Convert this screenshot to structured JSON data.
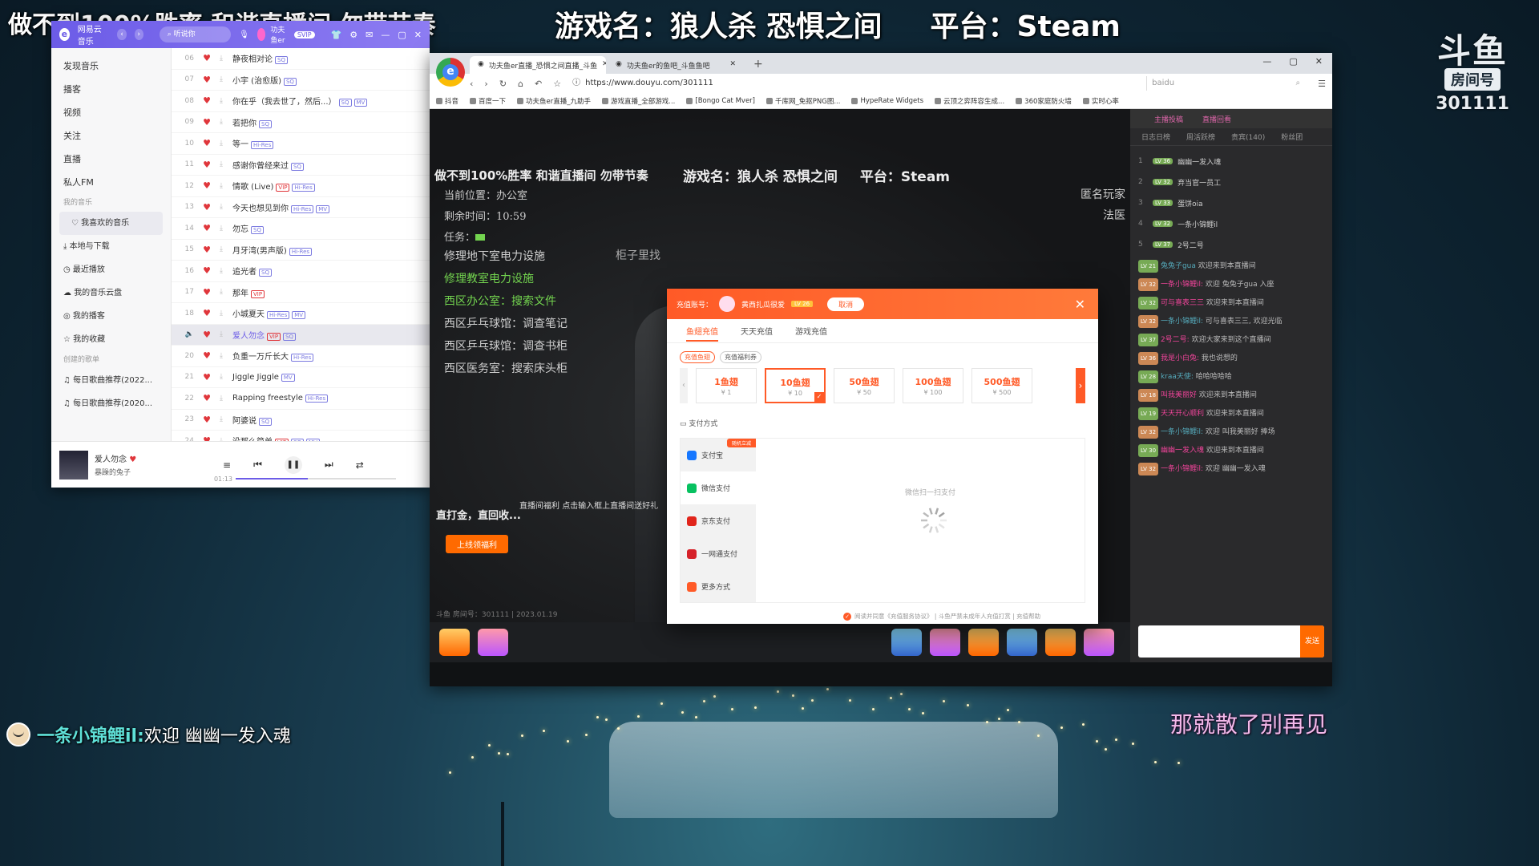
{
  "overlay": {
    "top_left_banner": "做不到100%胜率 和谐直播间 勿带节奏",
    "game_label": "游戏名：狼人杀 恐惧之间",
    "platform_label": "平台：Steam",
    "logo_text": "斗鱼",
    "logo_badge": "房间号",
    "room_number": "301111",
    "chat_user": "一条小锦鲤il:",
    "chat_message": "欢迎 幽幽一发入魂",
    "lyric": "那就散了别再见"
  },
  "music": {
    "app_name": "网易云音乐",
    "search_placeholder": "听说你",
    "user_name": "功夫鱼er",
    "user_vip": "SVIP",
    "nav": [
      {
        "label": "发现音乐"
      },
      {
        "label": "播客"
      },
      {
        "label": "视频"
      },
      {
        "label": "关注"
      },
      {
        "label": "直播"
      },
      {
        "label": "私人FM"
      }
    ],
    "my_music_section": "我的音乐",
    "my_items": [
      {
        "label": "我喜欢的音乐"
      },
      {
        "label": "本地与下载"
      },
      {
        "label": "最近播放"
      },
      {
        "label": "我的音乐云盘"
      },
      {
        "label": "我的播客"
      },
      {
        "label": "我的收藏"
      }
    ],
    "created_section": "创建的歌单",
    "playlists": [
      {
        "label": "每日歌曲推荐(2022..."
      },
      {
        "label": "每日歌曲推荐(2020..."
      }
    ],
    "songs": [
      {
        "no": "06",
        "title": "静夜相对论",
        "tags": [
          "SQ"
        ]
      },
      {
        "no": "07",
        "title": "小宇 (治愈版)",
        "tags": [
          "SQ"
        ]
      },
      {
        "no": "08",
        "title": "你在乎（我去世了，然后...）",
        "tags": [
          "SQ",
          "MV"
        ]
      },
      {
        "no": "09",
        "title": "若把你",
        "tags": [
          "SQ"
        ]
      },
      {
        "no": "10",
        "title": "等一",
        "tags": [
          "Hi-Res"
        ]
      },
      {
        "no": "11",
        "title": "感谢你曾经来过",
        "tags": [
          "SQ"
        ]
      },
      {
        "no": "12",
        "title": "情歌 (Live)",
        "tags": [
          "VIP",
          "Hi-Res"
        ]
      },
      {
        "no": "13",
        "title": "今天也想见到你",
        "tags": [
          "Hi-Res",
          "MV"
        ]
      },
      {
        "no": "14",
        "title": "勿忘",
        "tags": [
          "SQ"
        ]
      },
      {
        "no": "15",
        "title": "月牙湾(男声版)",
        "tags": [
          "Hi-Res"
        ]
      },
      {
        "no": "16",
        "title": "追光者",
        "tags": [
          "SQ"
        ]
      },
      {
        "no": "17",
        "title": "那年",
        "tags": [
          "VIP"
        ]
      },
      {
        "no": "18",
        "title": "小城夏天",
        "tags": [
          "Hi-Res",
          "MV"
        ]
      },
      {
        "no": "19",
        "title": "爱人勿念",
        "tags": [
          "VIP",
          "SQ"
        ],
        "playing": true
      },
      {
        "no": "20",
        "title": "负重一万斤长大",
        "tags": [
          "Hi-Res"
        ]
      },
      {
        "no": "21",
        "title": "Jiggle Jiggle",
        "tags": [
          "MV"
        ]
      },
      {
        "no": "22",
        "title": "Rapping freestyle",
        "tags": [
          "Hi-Res"
        ]
      },
      {
        "no": "23",
        "title": "阿婆说",
        "tags": [
          "SQ"
        ]
      },
      {
        "no": "24",
        "title": "没那么简单",
        "tags": [
          "VIP",
          "SQ",
          "MV"
        ]
      }
    ],
    "player": {
      "title": "爱人勿念",
      "artist": "暴躁的兔子",
      "time": "01:13",
      "progress": 0.45
    }
  },
  "browser": {
    "tabs": [
      {
        "label": "功夫鱼er直播_恐惧之间直播_斗鱼"
      },
      {
        "label": "功夫鱼er的鱼吧_斗鱼鱼吧"
      }
    ],
    "url": "https://www.douyu.com/301111",
    "search_engine": "baidu",
    "bookmarks": [
      {
        "label": "抖音"
      },
      {
        "label": "百度一下"
      },
      {
        "label": "功夫鱼er直播_九助手"
      },
      {
        "label": "游戏直播_全部游戏..."
      },
      {
        "label": "[Bongo Cat Mver]"
      },
      {
        "label": "千库网_免抠PNG图..."
      },
      {
        "label": "HypeRate Widgets"
      },
      {
        "label": "云顶之弈阵容生成..."
      },
      {
        "label": "360家庭防火墙"
      },
      {
        "label": "实时心率"
      }
    ]
  },
  "stream": {
    "banner": "做不到100%胜率 和谐直播间 勿带节奏",
    "game": "游戏名：狼人杀 恐惧之间",
    "platform": "平台：Steam",
    "location_label": "当前位置：办公室",
    "time_left": "剩余时间：10:59",
    "task_label": "任务：",
    "quests": [
      {
        "text": "修理地下室电力设施",
        "style": "d"
      },
      {
        "text": "修理教室电力设施",
        "style": "g"
      },
      {
        "text": "西区办公室：搜索文件",
        "style": "g"
      },
      {
        "text": "西区乒乓球馆：调查笔记",
        "style": "d"
      },
      {
        "text": "西区乒乓球馆：调查书柜",
        "style": "d"
      },
      {
        "text": "西区医务室：搜索床头柜",
        "style": "d"
      }
    ],
    "mid_label": "柜子里找",
    "right_text": [
      "匿名玩家",
      "法医"
    ],
    "promo_title": "直播间福利",
    "promo_tip": "点击输入框上直播间送好礼",
    "promo_sub": "直打金，直回收...",
    "promo_btn": "上线领福利",
    "status": "斗鱼 房间号：301111 | 2023.01.19"
  },
  "chat": {
    "tabs_top": [
      "主播投稿",
      "直播回看"
    ],
    "tabs": [
      "日志日榜",
      "周活跃榜",
      "贵宾(140)",
      "粉丝团"
    ],
    "ranks": [
      {
        "n": "1",
        "lv": "LV 36",
        "name": "幽幽一发入魂"
      },
      {
        "n": "2",
        "lv": "LV 32",
        "name": "弃当官一员工"
      },
      {
        "n": "3",
        "lv": "LV 33",
        "name": "蛋饼oia"
      },
      {
        "n": "4",
        "lv": "LV 32",
        "name": "一条小锦鲤il"
      },
      {
        "n": "5",
        "lv": "LV 37",
        "name": "2号二号"
      }
    ],
    "messages": [
      {
        "lv": "LV 21",
        "user": "兔兔子gua",
        "text": "欢迎来到本直播间"
      },
      {
        "lv": "LV 32",
        "user": "一条小锦鲤il:",
        "text": "欢迎 兔兔子gua 入座"
      },
      {
        "lv": "LV 32",
        "user": "可与喜表三三",
        "text": "欢迎来到本直播间"
      },
      {
        "lv": "LV 32",
        "user": "一条小锦鲤il:",
        "text": "可与喜表三三, 欢迎光临"
      },
      {
        "lv": "LV 37",
        "user": "2号二号:",
        "text": "欢迎大家来到这个直播间"
      },
      {
        "lv": "LV 36",
        "user": "我是小白兔:",
        "text": "我也说想的"
      },
      {
        "lv": "LV 28",
        "user": "kraa天使:",
        "text": "哈哈哈哈哈"
      },
      {
        "lv": "LV 18",
        "user": "叫我美丽好",
        "text": "欢迎来到本直播间"
      },
      {
        "lv": "LV 19",
        "user": "天天开心顺利",
        "text": "欢迎来到本直播间"
      },
      {
        "lv": "LV 32",
        "user": "一条小锦鲤il:",
        "text": "欢迎 叫我美丽好 捧场"
      },
      {
        "lv": "LV 30",
        "user": "幽幽一发入魂",
        "text": "欢迎来到本直播间"
      },
      {
        "lv": "LV 32",
        "user": "一条小锦鲤il:",
        "text": "欢迎 幽幽一发入魂"
      }
    ],
    "send_label": "发送"
  },
  "recharge": {
    "account_label": "充值账号：",
    "account_name": "黄西扎瓜很爱",
    "account_level": "LV 26",
    "cancel_label": "取消",
    "tabs": [
      "鱼翅充值",
      "天天充值",
      "游戏充值"
    ],
    "subtabs": [
      "充值鱼翅",
      "充值福利券"
    ],
    "amounts": [
      {
        "amount": "1鱼翅",
        "price": "¥ 1"
      },
      {
        "amount": "10鱼翅",
        "price": "¥ 10",
        "selected": true
      },
      {
        "amount": "50鱼翅",
        "price": "¥ 50"
      },
      {
        "amount": "100鱼翅",
        "price": "¥ 100"
      },
      {
        "amount": "500鱼翅",
        "price": "¥ 500"
      }
    ],
    "pay_label": "支付方式",
    "pay_methods": [
      {
        "label": "支付宝",
        "icon_color": "#1677ff",
        "badge": "随机立减"
      },
      {
        "label": "微信支付",
        "icon_color": "#07c160"
      },
      {
        "label": "京东支付",
        "icon_color": "#e1251b"
      },
      {
        "label": "一网通支付",
        "icon_color": "#d6222a"
      },
      {
        "label": "更多方式",
        "icon_color": "#ff5a27"
      }
    ],
    "qr_hint": "微信扫一扫支付",
    "agreement": "阅读并同意《充值服务协议》 | 斗鱼严禁未成年人充值打赏 | 充值帮助"
  },
  "colors": {
    "douyu_orange": "#ff5a27",
    "netease_purple": "#6c5ce7",
    "quest_green": "#73d44f"
  }
}
